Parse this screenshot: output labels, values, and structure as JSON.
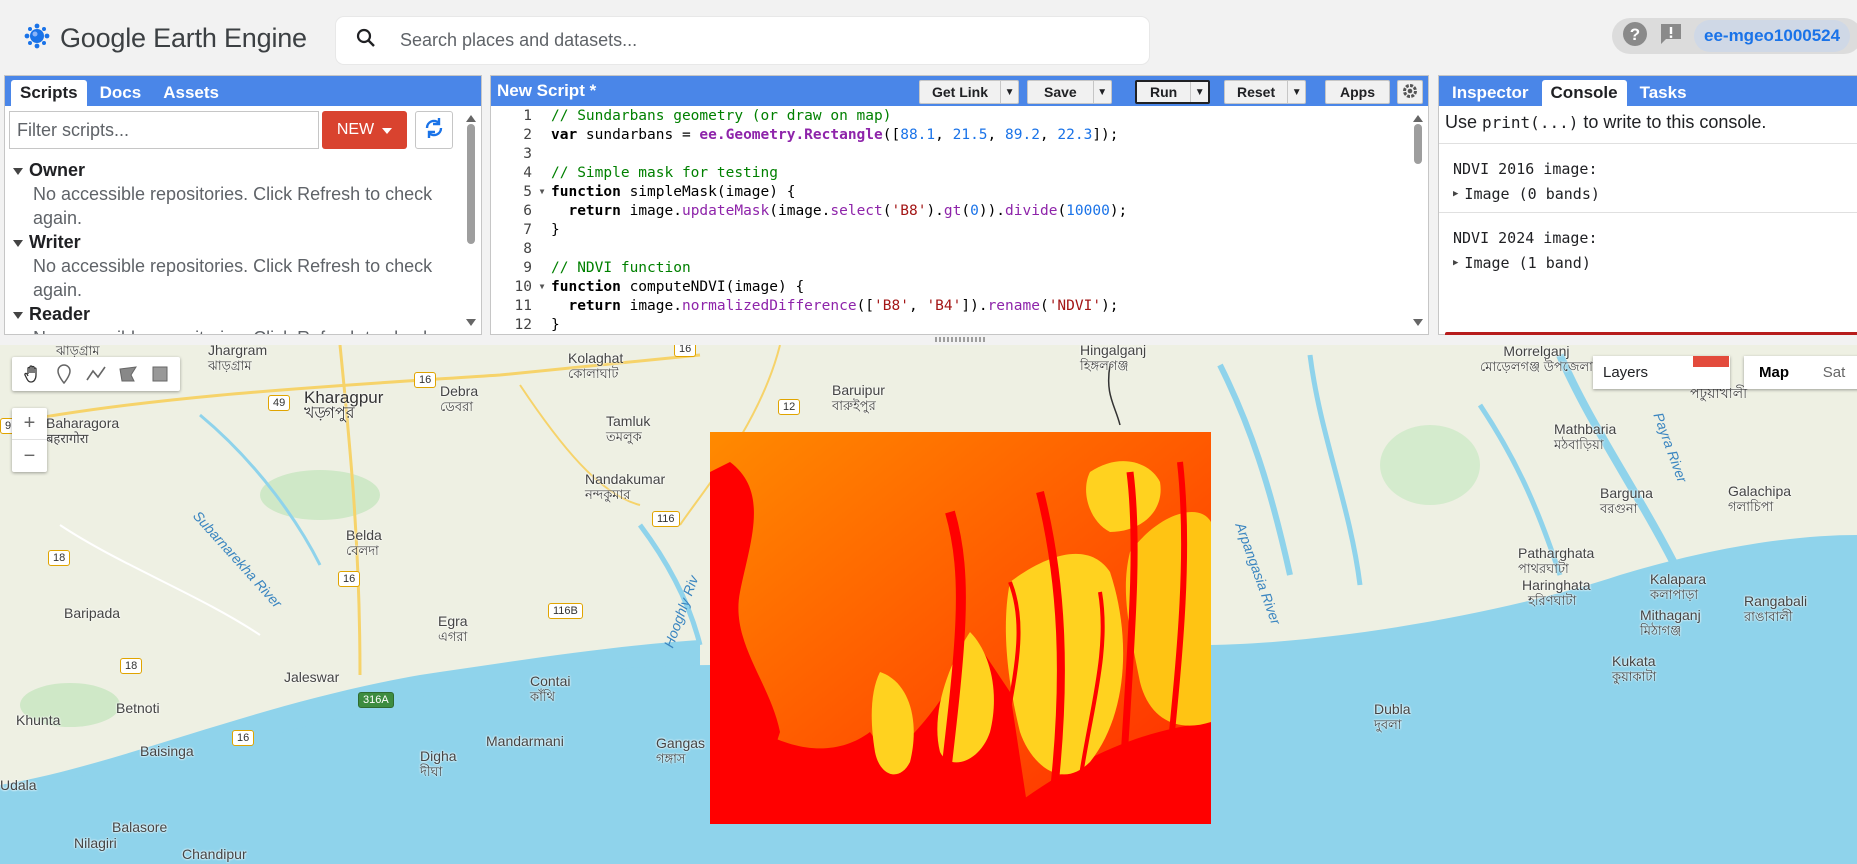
{
  "app": {
    "title": "Google Earth Engine"
  },
  "search": {
    "placeholder": "Search places and datasets..."
  },
  "account": {
    "user": "ee-mgeo1000524"
  },
  "scripts_panel": {
    "tabs": [
      "Scripts",
      "Docs",
      "Assets"
    ],
    "filter_placeholder": "Filter scripts...",
    "new_label": "NEW",
    "groups": [
      {
        "name": "Owner",
        "message": "No accessible repositories. Click Refresh to check again."
      },
      {
        "name": "Writer",
        "message": "No accessible repositories. Click Refresh to check again."
      },
      {
        "name": "Reader",
        "message": "No accessible repositories. Click Refresh to check again."
      }
    ]
  },
  "editor": {
    "title": "New Script *",
    "buttons": {
      "get_link": "Get Link",
      "save": "Save",
      "run": "Run",
      "reset": "Reset",
      "apps": "Apps"
    },
    "lines": [
      "// Sundarbans geometry (or draw on map)",
      "var sundarbans = ee.Geometry.Rectangle([88.1, 21.5, 89.2, 22.3]);",
      "",
      "// Simple mask for testing",
      "function simpleMask(image) {",
      "  return image.updateMask(image.select('B8').gt(0)).divide(10000);",
      "}",
      "",
      "// NDVI function",
      "function computeNDVI(image) {",
      "  return image.normalizedDifference(['B8', 'B4']).rename('NDVI');",
      "}"
    ],
    "line_numbers": [
      "1",
      "2",
      "3",
      "4",
      "5",
      "6",
      "7",
      "8",
      "9",
      "10",
      "11",
      "12"
    ]
  },
  "console_panel": {
    "tabs": [
      "Inspector",
      "Console",
      "Tasks"
    ],
    "hint_prefix": "Use ",
    "hint_code": "print(...)",
    "hint_suffix": " to write to this console.",
    "entries": [
      {
        "label": "NDVI 2016 image:",
        "value": "Image (0 bands)"
      },
      {
        "label": "NDVI 2024 image:",
        "value": "Image (1 band)"
      }
    ]
  },
  "map": {
    "layers_label": "Layers",
    "map_types": [
      "Map",
      "Sat"
    ],
    "zoom_in": "+",
    "zoom_out": "−",
    "places": [
      {
        "name": "Kharagpur",
        "local": "খড়্গপুর"
      },
      {
        "name": "Jhargram",
        "local": "ঝাড়গ্রাম"
      },
      {
        "name": "Debra",
        "local": "ডেবরা"
      },
      {
        "name": "Kolaghat",
        "local": "কোলাঘাট"
      },
      {
        "name": "Baruipur",
        "local": "বারুইপুর"
      },
      {
        "name": "Hingalganj",
        "local": "হিঙ্গলগঞ্জ"
      },
      {
        "name": "Baharagora",
        "local": "बहरागोरा"
      },
      {
        "name": "Tamluk",
        "local": "তমলুক"
      },
      {
        "name": "Nandakumar",
        "local": "নন্দকুমার"
      },
      {
        "name": "Belda",
        "local": "বেলদা"
      },
      {
        "name": "Baripada",
        "local": ""
      },
      {
        "name": "Egra",
        "local": "এগরা"
      },
      {
        "name": "Jaleswar",
        "local": ""
      },
      {
        "name": "Contai",
        "local": "কাঁথি"
      },
      {
        "name": "Betnoti",
        "local": ""
      },
      {
        "name": "Khunta",
        "local": ""
      },
      {
        "name": "Baisinga",
        "local": ""
      },
      {
        "name": "Digha",
        "local": "দীঘা"
      },
      {
        "name": "Mandarmani",
        "local": ""
      },
      {
        "name": "Gangas",
        "local": "গঙ্গাস"
      },
      {
        "name": "Balasore",
        "local": ""
      },
      {
        "name": "Nilagiri",
        "local": ""
      },
      {
        "name": "Chandipur",
        "local": ""
      },
      {
        "name": "Udala",
        "local": ""
      },
      {
        "name": "Mathbaria",
        "local": "মঠবাড়িয়া"
      },
      {
        "name": "Barguna",
        "local": "বরগুনা"
      },
      {
        "name": "Galachipa",
        "local": "গলাচিপা"
      },
      {
        "name": "Patharghata",
        "local": "পাথরঘাটা"
      },
      {
        "name": "Haringhata",
        "local": "হরিণঘাটা"
      },
      {
        "name": "Kalapara",
        "local": "কলাপাড়া"
      },
      {
        "name": "Mithaganj",
        "local": "মিঠাগঞ্জ"
      },
      {
        "name": "Rangabali",
        "local": "রাঙাবালী"
      },
      {
        "name": "Kukata",
        "local": "কুয়াকাটা"
      },
      {
        "name": "Dubla",
        "local": "দুবলা"
      },
      {
        "name": "Morrelganj",
        "local": "মোড়েলগঞ্জ উপজেলা"
      },
      {
        "name": "Patuakhali",
        "local": "পটুয়াখালী"
      }
    ],
    "rivers": [
      "Subarnarekha River",
      "Hooghly Riv",
      "Arpangasia River",
      "Payra River"
    ],
    "roads": [
      "16",
      "49",
      "12",
      "16",
      "116",
      "18",
      "16",
      "116B",
      "18",
      "316A",
      "16",
      "9"
    ]
  }
}
